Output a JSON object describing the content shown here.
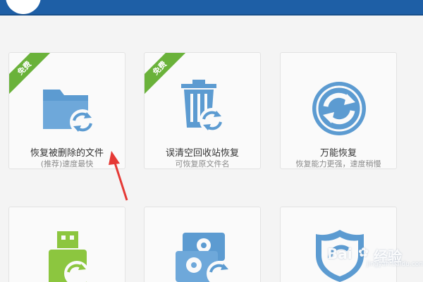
{
  "colors": {
    "top_bar": "#1e5fa6",
    "icon_blue": "#5c9bd1",
    "ribbon_green": "#6ab23a",
    "usb_green": "#8cc63f",
    "arrow_red": "#e53935"
  },
  "cards": [
    {
      "title": "恢复被删除的文件",
      "subtitle": "(推荐)速度最快",
      "badge": "免费",
      "icon": "folder-restore-icon"
    },
    {
      "title": "误清空回收站恢复",
      "subtitle": "可恢复原文件名",
      "badge": "免费",
      "icon": "recycle-bin-restore-icon"
    },
    {
      "title": "万能恢复",
      "subtitle": "恢复能力更强，速度稍慢",
      "icon": "universal-restore-icon"
    },
    {
      "icon": "usb-restore-icon"
    },
    {
      "icon": "disk-restore-icon"
    },
    {
      "icon": "shield-icon"
    }
  ],
  "watermark": {
    "brand": "Bai",
    "brand_tail": "经验",
    "sub": "jingyan.baidu.com"
  }
}
